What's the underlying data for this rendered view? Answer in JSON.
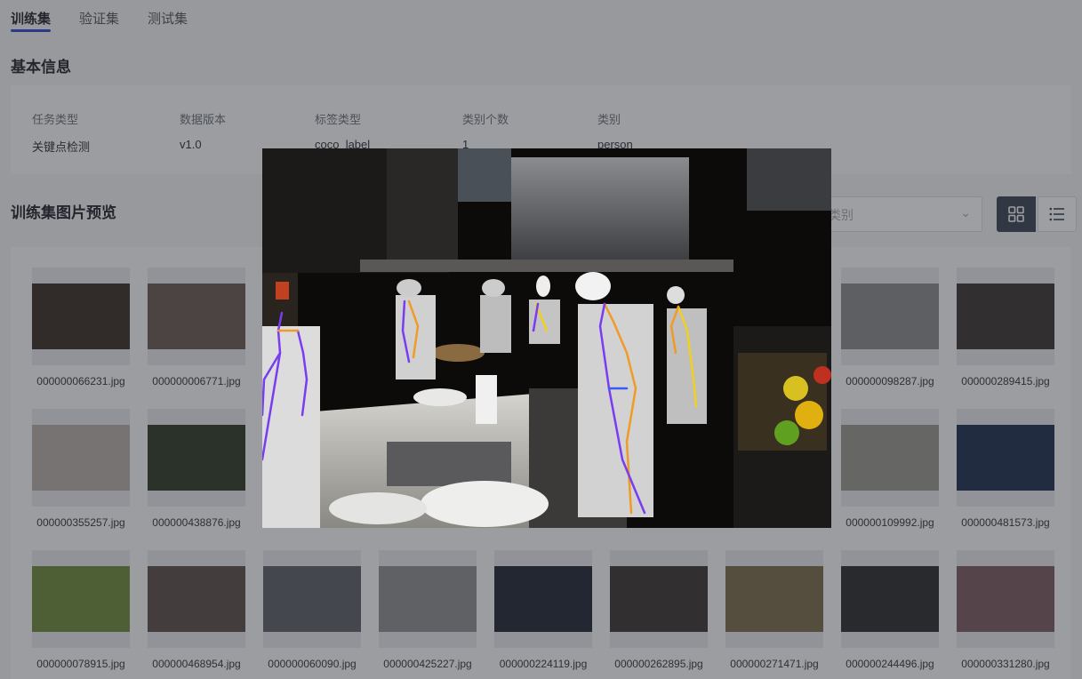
{
  "tabs": [
    {
      "label": "训练集",
      "active": true
    },
    {
      "label": "验证集",
      "active": false
    },
    {
      "label": "测试集",
      "active": false
    }
  ],
  "basic_info": {
    "title": "基本信息",
    "fields": [
      {
        "key": "任务类型",
        "value": "关键点检测"
      },
      {
        "key": "数据版本",
        "value": "v1.0"
      },
      {
        "key": "标签类型",
        "value": "coco_label"
      },
      {
        "key": "类别个数",
        "value": "1"
      },
      {
        "key": "类别",
        "value": "person"
      }
    ]
  },
  "preview_section": {
    "title": "训练集图片预览",
    "filter_placeholder": "签类别",
    "view_modes": [
      "grid-icon",
      "list-icon"
    ],
    "active_view": "grid"
  },
  "images": [
    {
      "name": "000000066231.jpg",
      "tone": "#3a2e26"
    },
    {
      "name": "000000006771.jpg",
      "tone": "#6a5a52"
    },
    {
      "name": "",
      "tone": "#555"
    },
    {
      "name": "",
      "tone": "#555"
    },
    {
      "name": "",
      "tone": "#555"
    },
    {
      "name": "",
      "tone": "#555"
    },
    {
      "name": "",
      "tone": "#555"
    },
    {
      "name": "000000098287.jpg",
      "tone": "#8a8a8a"
    },
    {
      "name": "000000289415.jpg",
      "tone": "#3a3430"
    },
    {
      "name": "000000355257.jpg",
      "tone": "#b8b0a8"
    },
    {
      "name": "000000438876.jpg",
      "tone": "#2e3a24"
    },
    {
      "name": "",
      "tone": "#555"
    },
    {
      "name": "",
      "tone": "#555"
    },
    {
      "name": "",
      "tone": "#555"
    },
    {
      "name": "",
      "tone": "#555"
    },
    {
      "name": "",
      "tone": "#555"
    },
    {
      "name": "000000109992.jpg",
      "tone": "#9a9890"
    },
    {
      "name": "000000481573.jpg",
      "tone": "#1c2e4e"
    },
    {
      "name": "000000078915.jpg",
      "tone": "#6f8a3a"
    },
    {
      "name": "000000468954.jpg",
      "tone": "#5a4e4a"
    },
    {
      "name": "000000060090.jpg",
      "tone": "#5d6066"
    },
    {
      "name": "000000425227.jpg",
      "tone": "#8c8e90"
    },
    {
      "name": "000000224119.jpg",
      "tone": "#1f2533"
    },
    {
      "name": "000000262895.jpg",
      "tone": "#3a342e"
    },
    {
      "name": "000000271471.jpg",
      "tone": "#7a6a48"
    },
    {
      "name": "000000244496.jpg",
      "tone": "#2a2a2c"
    },
    {
      "name": "000000331280.jpg",
      "tone": "#7a5a60"
    }
  ],
  "colors": {
    "accent": "#2f47d6",
    "overlay": "rgba(40,42,48,0.45)",
    "skeleton_left": "#7a3cf0",
    "skeleton_right": "#f0d020",
    "skeleton_orange": "#f09a28",
    "skeleton_blue": "#3a5cf0"
  }
}
